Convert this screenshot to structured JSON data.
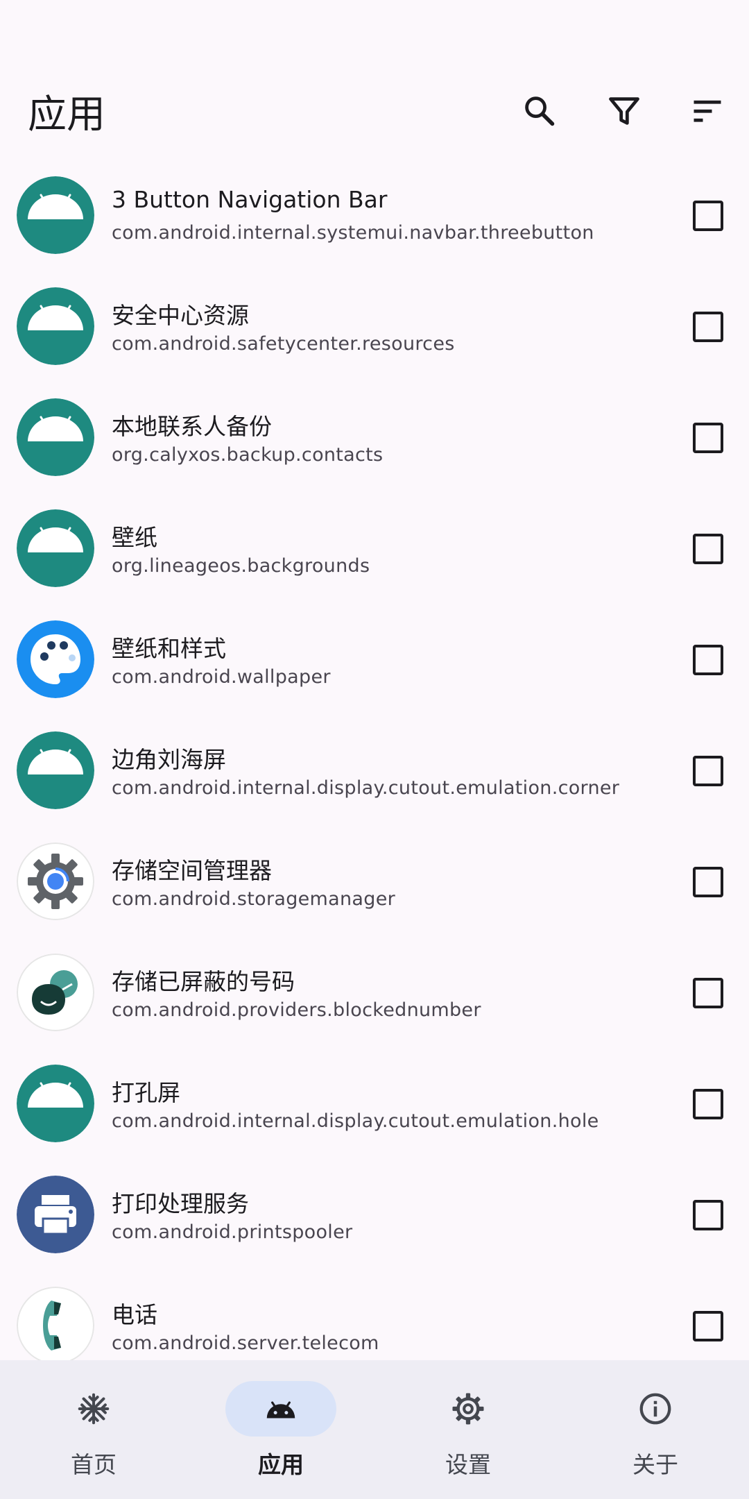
{
  "header": {
    "title": "应用",
    "actions": [
      "search-icon",
      "filter-icon",
      "sort-icon"
    ]
  },
  "apps": [
    {
      "name": "3 Button Navigation Bar",
      "package": "com.android.internal.systemui.navbar.threebutton",
      "icon": "android-icon",
      "checked": false
    },
    {
      "name": "安全中心资源",
      "package": "com.android.safetycenter.resources",
      "icon": "android-icon",
      "checked": false
    },
    {
      "name": "本地联系人备份",
      "package": "org.calyxos.backup.contacts",
      "icon": "android-icon",
      "checked": false
    },
    {
      "name": "壁纸",
      "package": "org.lineageos.backgrounds",
      "icon": "android-icon",
      "checked": false
    },
    {
      "name": "壁纸和样式",
      "package": "com.android.wallpaper",
      "icon": "palette-icon",
      "checked": false
    },
    {
      "name": "边角刘海屏",
      "package": "com.android.internal.display.cutout.emulation.corner",
      "icon": "android-icon",
      "checked": false
    },
    {
      "name": "存储空间管理器",
      "package": "com.android.storagemanager",
      "icon": "storage-gear-icon",
      "checked": false
    },
    {
      "name": "存储已屏蔽的号码",
      "package": "com.android.providers.blockednumber",
      "icon": "blocked-number-icon",
      "checked": false
    },
    {
      "name": "打孔屏",
      "package": "com.android.internal.display.cutout.emulation.hole",
      "icon": "android-icon",
      "checked": false
    },
    {
      "name": "打印处理服务",
      "package": "com.android.printspooler",
      "icon": "printer-icon",
      "checked": false
    },
    {
      "name": "电话",
      "package": "com.android.server.telecom",
      "icon": "phone-icon",
      "checked": false
    }
  ],
  "bottom_nav": [
    {
      "label": "首页",
      "icon": "snowflake-icon",
      "active": false
    },
    {
      "label": "应用",
      "icon": "android-head-icon",
      "active": true
    },
    {
      "label": "设置",
      "icon": "gear-icon",
      "active": false
    },
    {
      "label": "关于",
      "icon": "info-icon",
      "active": false
    }
  ],
  "colors": {
    "background": "#fcf8fc",
    "android_teal": "#1e8a80",
    "nav_background": "#eeedf4",
    "nav_active_pill": "#d9e3f8"
  }
}
